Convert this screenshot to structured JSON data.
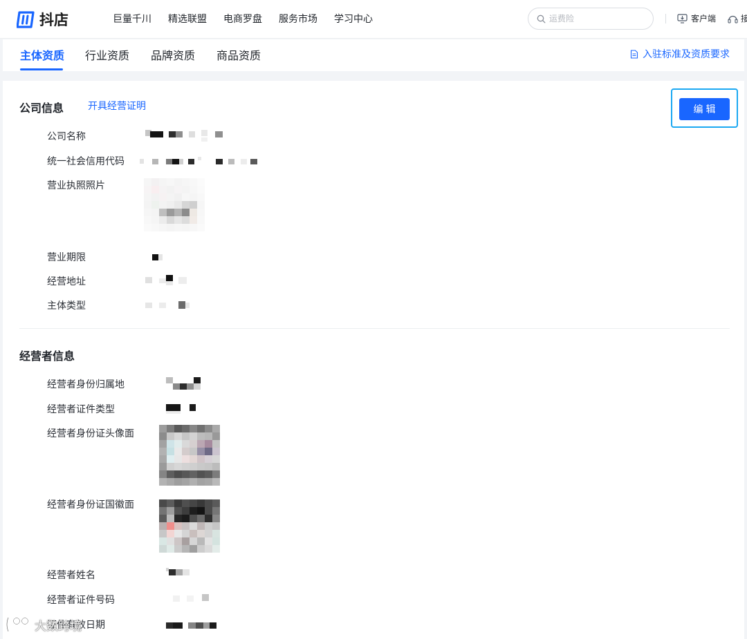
{
  "header": {
    "logo_text": "抖店",
    "nav": [
      "巨量千川",
      "精选联盟",
      "电商罗盘",
      "服务市场",
      "学习中心"
    ],
    "search_placeholder": "运费险",
    "client_label": "客户端",
    "help_label": "接"
  },
  "tabs": {
    "items": [
      "主体资质",
      "行业资质",
      "品牌资质",
      "商品资质"
    ],
    "active_index": 0,
    "right_link": "入驻标准及资质要求"
  },
  "company": {
    "title": "公司信息",
    "link": "开具经营证明",
    "edit_label": "编辑",
    "fields": [
      "公司名称",
      "统一社会信用代码",
      "营业执照照片",
      "营业期限",
      "经营地址",
      "主体类型"
    ]
  },
  "operator": {
    "title": "经营者信息",
    "fields": [
      "经营者身份归属地",
      "经营者证件类型",
      "经营者身份证头像面",
      "经营者身份证国徽面",
      "经营者姓名",
      "经营者证件号码",
      "证件有效日期"
    ]
  },
  "watermark": "大数跨境",
  "colors": {
    "accent": "#1966ff",
    "highlight_border": "#1aa8f2"
  }
}
